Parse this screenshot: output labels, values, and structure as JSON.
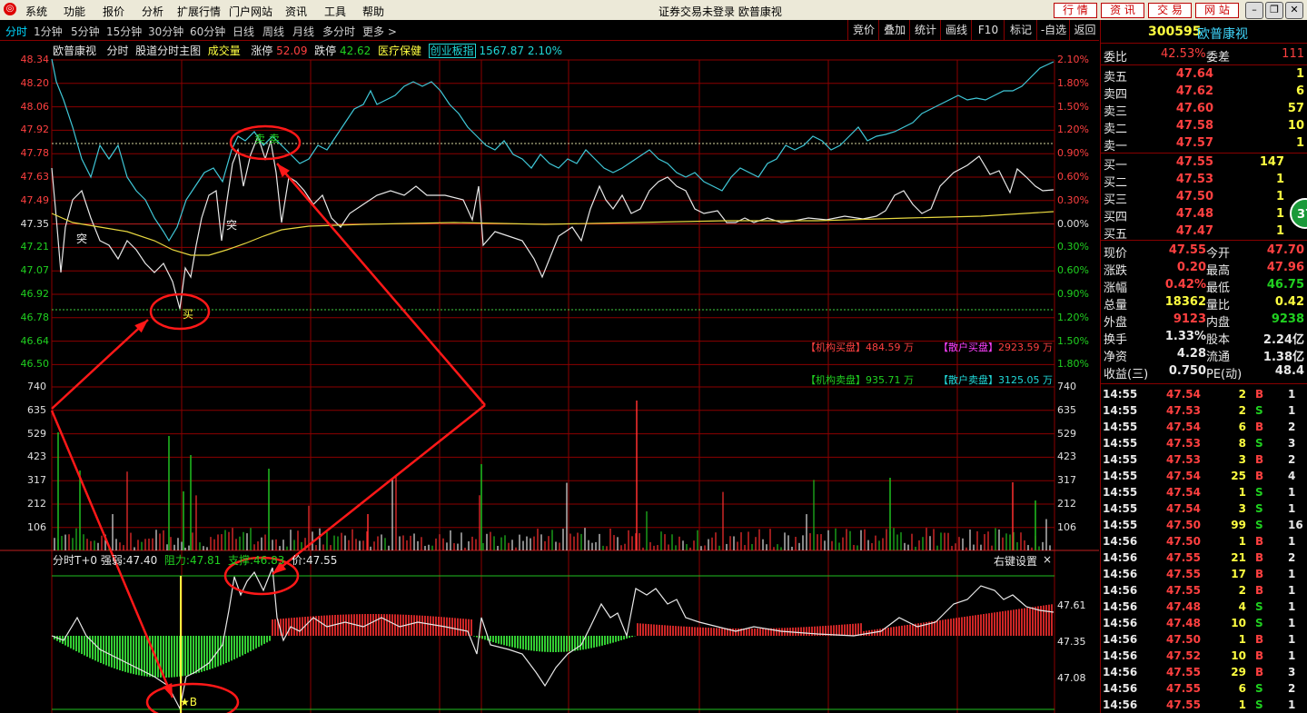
{
  "menu": {
    "items": [
      "系统",
      "功能",
      "报价",
      "分析",
      "扩展行情",
      "门户网站",
      "资讯",
      "工具",
      "帮助"
    ],
    "window_title": "证券交易未登录  欧普康视",
    "nav_buttons": [
      "行 情",
      "资 讯",
      "交 易",
      "网 站"
    ]
  },
  "tabs": {
    "periods": [
      "分时",
      "1分钟",
      "5分钟",
      "15分钟",
      "30分钟",
      "60分钟",
      "日线",
      "周线",
      "月线",
      "多分时",
      "更多 >"
    ],
    "right": [
      "竞价",
      "叠加",
      "统计",
      "画线",
      "F10",
      "标记",
      "-自选",
      "返回"
    ]
  },
  "chart_header": {
    "stock_name": "欧普康视",
    "mode": "分时",
    "main_chart_label": "股道分时主图",
    "volume_label": "成交量",
    "limit_up_label": "涨停",
    "limit_up": "52.09",
    "limit_down_label": "跌停",
    "limit_down": "42.62",
    "sector": "医疗保健",
    "index_name": "创业板指",
    "index_value": "1567.87",
    "index_change": "2.10%"
  },
  "price_axis": [
    "48.34",
    "48.20",
    "48.06",
    "47.92",
    "47.78",
    "47.63",
    "47.49",
    "47.35",
    "47.21",
    "47.07",
    "46.92",
    "46.78",
    "46.64",
    "46.50"
  ],
  "pct_axis": [
    "2.10%",
    "1.80%",
    "1.50%",
    "1.20%",
    "0.90%",
    "0.60%",
    "0.30%",
    "0.00%",
    "0.30%",
    "0.60%",
    "0.90%",
    "1.20%",
    "1.50%",
    "1.80%"
  ],
  "volume_axis": [
    "740",
    "635",
    "529",
    "423",
    "317",
    "212",
    "106"
  ],
  "annotations": {
    "break_labels": [
      "突",
      "突"
    ],
    "sell_label": "卖 卖",
    "buy_label": "买",
    "star_buy": "★B"
  },
  "flows": {
    "inst_buy_label": "【机构买盘】",
    "inst_buy": "484.59 万",
    "retail_buy_label": "【散户买盘】",
    "retail_buy": "2923.59 万",
    "inst_sell_label": "【机构卖盘】",
    "inst_sell": "935.71 万",
    "retail_sell_label": "【散户卖盘】",
    "retail_sell": "3125.05 万"
  },
  "indicator": {
    "name": "分时T+0",
    "strength_label": "强弱:",
    "strength": "47.40",
    "resistance_label": "阻力:",
    "resistance": "47.81",
    "support_label": "支撑:",
    "support": "46.83",
    "price_label": "价:",
    "price": "47.55",
    "settings": "右键设置",
    "close": "×",
    "axis": [
      "47.61",
      "47.35",
      "47.08"
    ]
  },
  "quote": {
    "code": "300595",
    "name": "欧普康视",
    "weibi_label": "委比",
    "weibi": "42.53%",
    "weicha_label": "委差",
    "weicha": "111",
    "asks": [
      {
        "label": "卖五",
        "price": "47.64",
        "vol": "1"
      },
      {
        "label": "卖四",
        "price": "47.62",
        "vol": "6"
      },
      {
        "label": "卖三",
        "price": "47.60",
        "vol": "57"
      },
      {
        "label": "卖二",
        "price": "47.58",
        "vol": "10"
      },
      {
        "label": "卖一",
        "price": "47.57",
        "vol": "1"
      }
    ],
    "bids": [
      {
        "label": "买一",
        "price": "47.55",
        "vol": "147"
      },
      {
        "label": "买二",
        "price": "47.53",
        "vol": "1"
      },
      {
        "label": "买三",
        "price": "47.50",
        "vol": "1"
      },
      {
        "label": "买四",
        "price": "47.48",
        "vol": "1"
      },
      {
        "label": "买五",
        "price": "47.47",
        "vol": "1"
      }
    ],
    "stats": [
      {
        "l1": "现价",
        "v1": "47.55",
        "l2": "今开",
        "v2": "47.70"
      },
      {
        "l1": "涨跌",
        "v1": "0.20",
        "l2": "最高",
        "v2": "47.96"
      },
      {
        "l1": "涨幅",
        "v1": "0.42%",
        "l2": "最低",
        "v2": "46.75"
      },
      {
        "l1": "总量",
        "v1": "18362",
        "l2": "量比",
        "v2": "0.42"
      },
      {
        "l1": "外盘",
        "v1": "9123",
        "l2": "内盘",
        "v2": "9238"
      },
      {
        "l1": "换手",
        "v1": "1.33%",
        "l2": "股本",
        "v2": "2.24亿"
      },
      {
        "l1": "净资",
        "v1": "4.28",
        "l2": "流通",
        "v2": "1.38亿"
      },
      {
        "l1": "收益(三)",
        "v1": "0.750",
        "l2": "PE(动)",
        "v2": "48.4"
      }
    ],
    "badge": "37"
  },
  "ticks": [
    {
      "t": "14:55",
      "p": "47.54",
      "v": "2",
      "d": "B",
      "n": "1"
    },
    {
      "t": "14:55",
      "p": "47.53",
      "v": "2",
      "d": "S",
      "n": "1"
    },
    {
      "t": "14:55",
      "p": "47.54",
      "v": "6",
      "d": "B",
      "n": "2"
    },
    {
      "t": "14:55",
      "p": "47.53",
      "v": "8",
      "d": "S",
      "n": "3"
    },
    {
      "t": "14:55",
      "p": "47.53",
      "v": "3",
      "d": "B",
      "n": "2"
    },
    {
      "t": "14:55",
      "p": "47.54",
      "v": "25",
      "d": "B",
      "n": "4"
    },
    {
      "t": "14:55",
      "p": "47.54",
      "v": "1",
      "d": "S",
      "n": "1"
    },
    {
      "t": "14:55",
      "p": "47.54",
      "v": "3",
      "d": "S",
      "n": "1"
    },
    {
      "t": "14:55",
      "p": "47.50",
      "v": "99",
      "d": "S",
      "n": "16"
    },
    {
      "t": "14:56",
      "p": "47.50",
      "v": "1",
      "d": "B",
      "n": "1"
    },
    {
      "t": "14:56",
      "p": "47.55",
      "v": "21",
      "d": "B",
      "n": "2"
    },
    {
      "t": "14:56",
      "p": "47.55",
      "v": "17",
      "d": "B",
      "n": "1"
    },
    {
      "t": "14:56",
      "p": "47.55",
      "v": "2",
      "d": "B",
      "n": "1"
    },
    {
      "t": "14:56",
      "p": "47.48",
      "v": "4",
      "d": "S",
      "n": "1"
    },
    {
      "t": "14:56",
      "p": "47.48",
      "v": "10",
      "d": "S",
      "n": "1"
    },
    {
      "t": "14:56",
      "p": "47.50",
      "v": "1",
      "d": "B",
      "n": "1"
    },
    {
      "t": "14:56",
      "p": "47.52",
      "v": "10",
      "d": "B",
      "n": "1"
    },
    {
      "t": "14:56",
      "p": "47.55",
      "v": "29",
      "d": "B",
      "n": "3"
    },
    {
      "t": "14:56",
      "p": "47.55",
      "v": "6",
      "d": "S",
      "n": "2"
    },
    {
      "t": "14:56",
      "p": "47.55",
      "v": "1",
      "d": "S",
      "n": "1"
    }
  ],
  "colors": {
    "up": "#ff4040",
    "down": "#20d020",
    "grid": "#8b0000",
    "accent": "#00d8ff"
  }
}
